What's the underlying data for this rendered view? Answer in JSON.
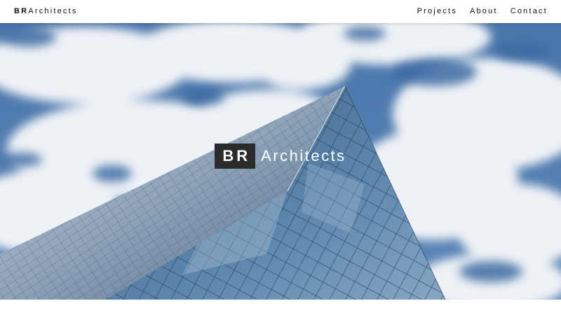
{
  "nav": {
    "brand_bold": "BR",
    "brand_rest": "Architects",
    "links": [
      "Projects",
      "About",
      "Contact"
    ]
  },
  "hero": {
    "logo_bold": "BR",
    "logo_rest": "Architects",
    "image": "skyscraper-sky-photo"
  },
  "colors": {
    "sky": "#3f6fa6",
    "cloud": "#eef2f6",
    "glass": "#5f86a8",
    "logo_box": "#2b2b2b",
    "nav_text": "#111111"
  }
}
